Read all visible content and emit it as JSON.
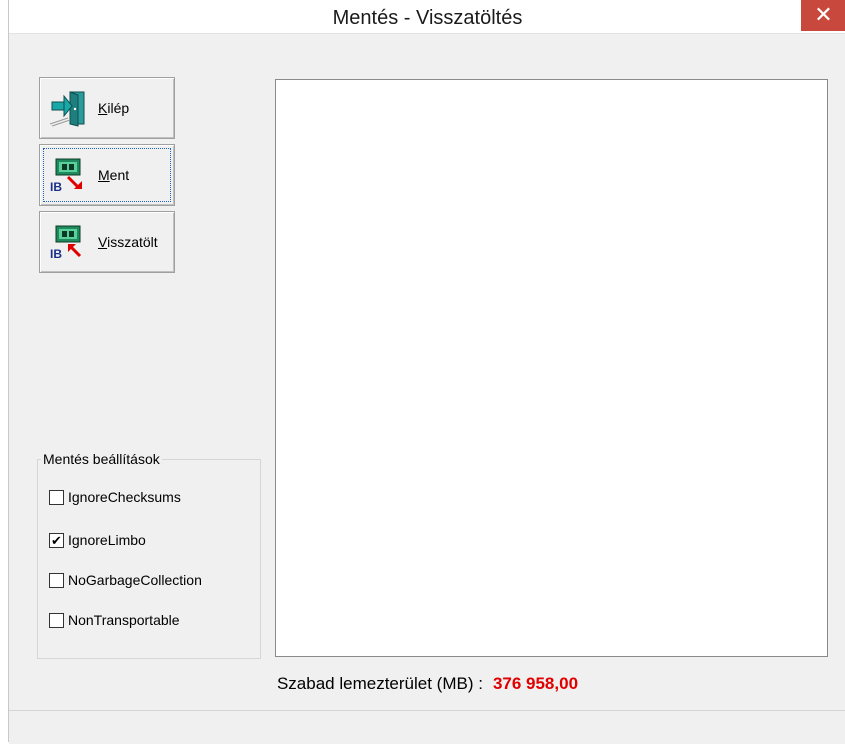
{
  "window": {
    "title": "Mentés - Visszatöltés",
    "close_glyph": "✕"
  },
  "toolbar": {
    "buttons": [
      {
        "label_first": "K",
        "label_rest": "ilép",
        "icon": "exit-door-icon"
      },
      {
        "label_first": "M",
        "label_rest": "ent",
        "icon": "backup-save-icon"
      },
      {
        "label_first": "V",
        "label_rest": "isszatölt",
        "icon": "restore-icon"
      }
    ]
  },
  "options": {
    "legend": "Mentés beállítások",
    "items": [
      {
        "label": "IgnoreChecksums",
        "checked": false
      },
      {
        "label": "IgnoreLimbo",
        "checked": true
      },
      {
        "label": "NoGarbageCollection",
        "checked": false
      },
      {
        "label": "NonTransportable",
        "checked": false
      }
    ]
  },
  "status": {
    "label": "Szabad lemezterület (MB) :",
    "value": "376 958,00"
  },
  "colors": {
    "accent_red": "#e00000",
    "close_button": "#c9483e",
    "focus": "#1a62c6"
  }
}
